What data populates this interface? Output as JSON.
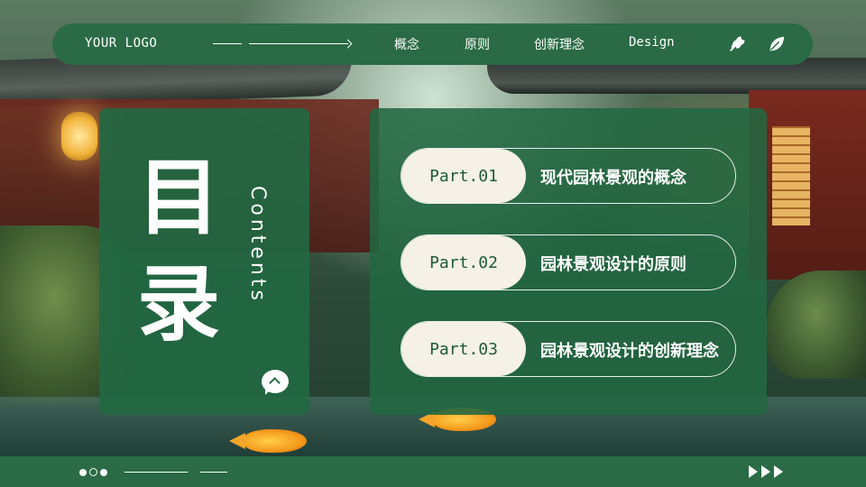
{
  "header": {
    "logo": "YOUR LOGO",
    "nav": [
      "概念",
      "原则",
      "创新理念",
      "Design"
    ],
    "icons": [
      "wheat-icon",
      "leaf-icon"
    ]
  },
  "title_card": {
    "char_1": "目",
    "char_2": "录",
    "subtitle": "Contents",
    "icon": "chat-up-icon"
  },
  "contents": [
    {
      "part": "Part.01",
      "title": "现代园林景观的概念"
    },
    {
      "part": "Part.02",
      "title": "园林景观设计的原则"
    },
    {
      "part": "Part.03",
      "title": "园林景观设计的创新理念"
    }
  ],
  "footer": {
    "icons": [
      "pagination-dots-icon",
      "chevrons-right-icon"
    ]
  },
  "colors": {
    "primary_green": "#2a6b45",
    "pill_cream": "#f5f1e6",
    "text_white": "#ffffff"
  }
}
